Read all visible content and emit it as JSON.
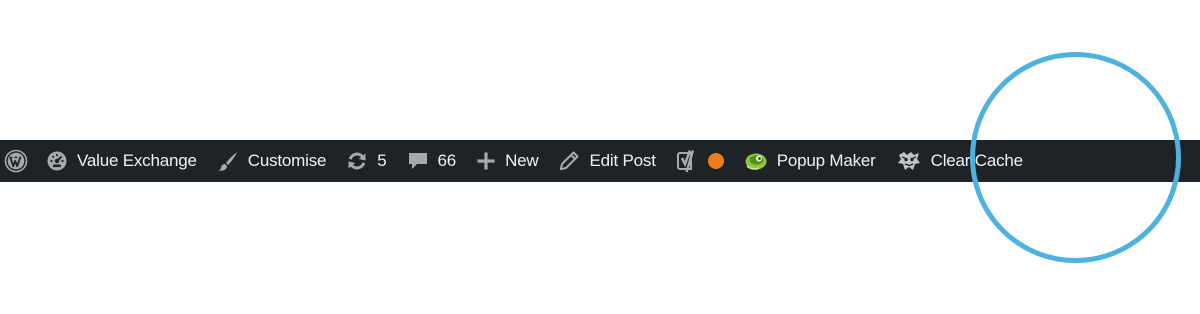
{
  "adminbar": {
    "wp_logo_icon": "wordpress-icon",
    "site": {
      "icon": "dashboard-gauge-icon",
      "label": "Value Exchange"
    },
    "customise": {
      "icon": "paintbrush-icon",
      "label": "Customise"
    },
    "updates": {
      "icon": "refresh-icon",
      "count": "5"
    },
    "comments": {
      "icon": "comment-bubble-icon",
      "count": "66"
    },
    "new": {
      "icon": "plus-icon",
      "label": "New"
    },
    "edit": {
      "icon": "pencil-icon",
      "label": "Edit Post"
    },
    "yoast": {
      "icon": "yoast-icon",
      "status_color": "#ee7c1b"
    },
    "popup_maker": {
      "icon": "popup-maker-icon",
      "label": "Popup Maker"
    },
    "clear_cache": {
      "icon": "wp-fastest-cache-icon",
      "label": "Clear Cache"
    }
  },
  "colors": {
    "bar_background": "#1d2327",
    "text": "#f0f0f1",
    "highlight_ring": "#4fb2de"
  }
}
